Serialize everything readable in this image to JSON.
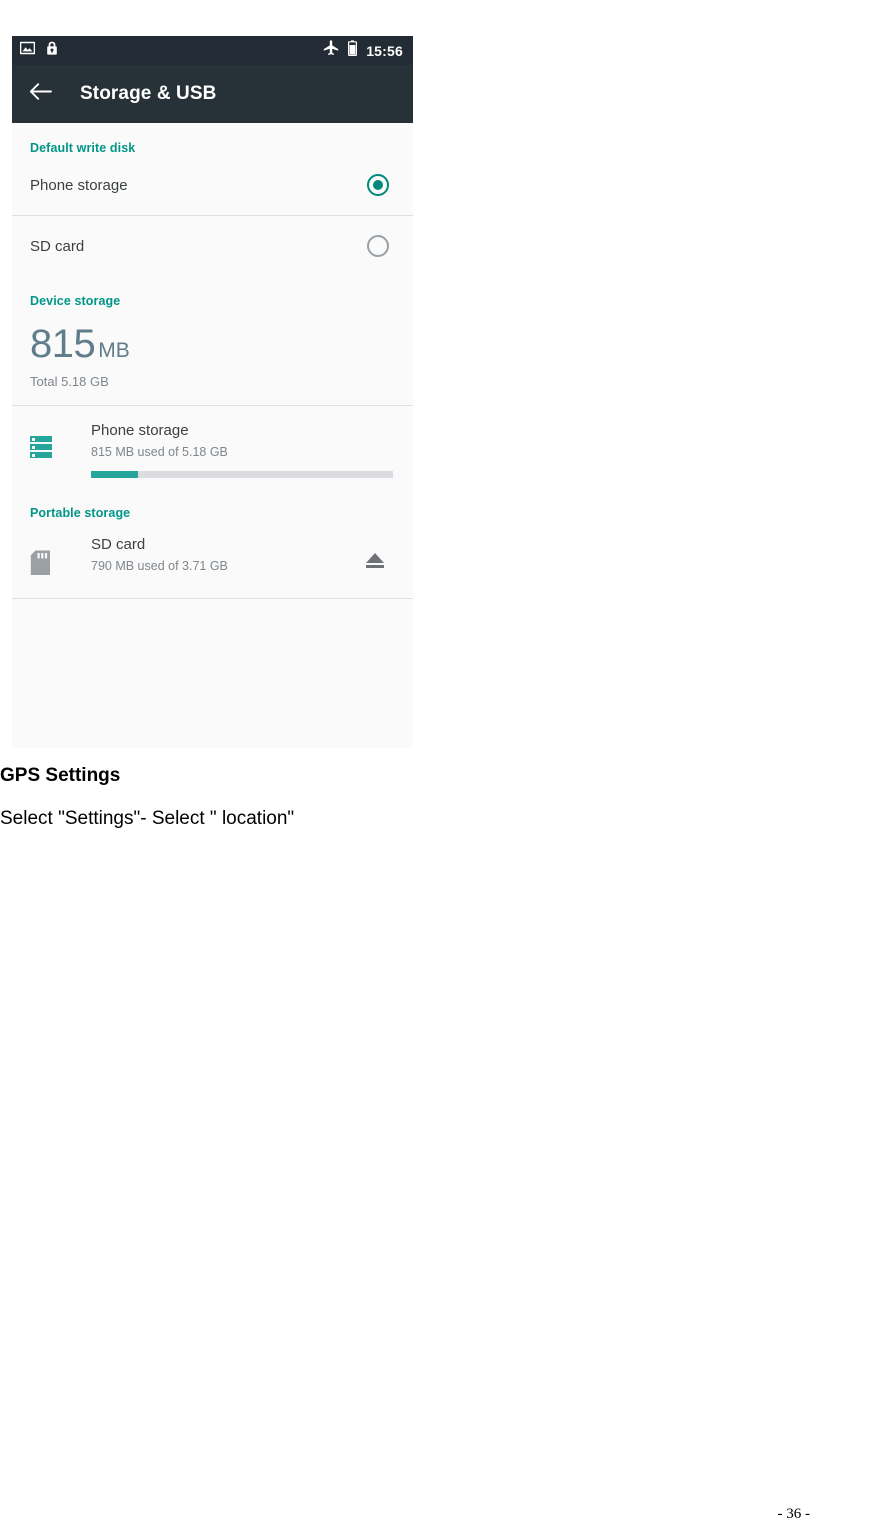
{
  "screenshot": {
    "status_bar": {
      "icons_left": [
        "screenshot-image-icon",
        "lock-icon"
      ],
      "icons_right": [
        "airplane-mode-icon",
        "battery-icon"
      ],
      "clock": "15:56"
    },
    "action_bar": {
      "back_icon": "back-arrow-icon",
      "title": "Storage & USB"
    },
    "sections": {
      "default_write_disk": {
        "header": "Default write disk",
        "options": [
          {
            "label": "Phone storage",
            "selected": true
          },
          {
            "label": "SD card",
            "selected": false
          }
        ]
      },
      "device_storage": {
        "header": "Device storage",
        "used_value": "815",
        "used_unit": "MB",
        "total": "Total 5.18 GB",
        "entry": {
          "icon": "internal-storage-icon",
          "title": "Phone storage",
          "subtitle": "815 MB used of 5.18 GB",
          "progress_percent": 15.5
        }
      },
      "portable_storage": {
        "header": "Portable storage",
        "entry": {
          "icon": "sd-card-icon",
          "title": "SD card",
          "subtitle": "790 MB used of 3.71 GB",
          "action_icon": "eject-icon"
        }
      }
    },
    "colors": {
      "status_bar_bg": "#232c35",
      "action_bar_bg": "#263238",
      "section_header": "#009688",
      "accent_teal": "#26a69a",
      "radio_selected": "#00897b",
      "summary_number": "#607d8b",
      "list_bg": "#fafafa"
    }
  },
  "document": {
    "heading": "GPS Settings",
    "paragraph": "Select \"Settings\"- Select \" location\"",
    "page_number": "- 36 -"
  }
}
